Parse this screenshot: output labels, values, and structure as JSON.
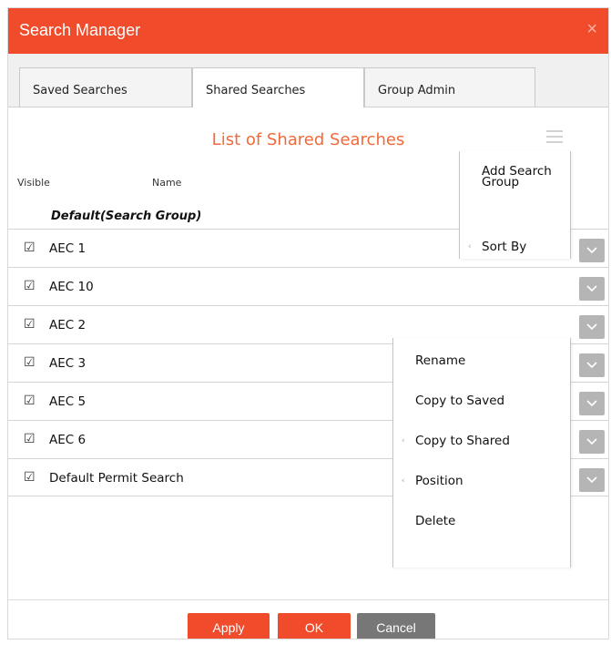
{
  "dialog": {
    "title": "Search Manager",
    "close_glyph": "×"
  },
  "tabs": [
    {
      "label": "Saved Searches"
    },
    {
      "label": "Shared Searches",
      "active": true
    },
    {
      "label": "Group Admin"
    }
  ],
  "list": {
    "heading": "List of Shared Searches",
    "columns": {
      "visible": "Visible",
      "name": "Name"
    },
    "group_name": "Default(Search Group)",
    "rows": [
      {
        "label": "AEC 1",
        "checked": true
      },
      {
        "label": "AEC 10",
        "checked": true
      },
      {
        "label": "AEC 2",
        "checked": true
      },
      {
        "label": "AEC 3",
        "checked": true
      },
      {
        "label": "AEC 5",
        "checked": true
      },
      {
        "label": "AEC 6",
        "checked": true
      },
      {
        "label": "Default Permit Search",
        "checked": true
      }
    ]
  },
  "group_menu": {
    "items": [
      "Add Search Group",
      "Sort By"
    ]
  },
  "row_menu": {
    "items": [
      "Rename",
      "Copy to Saved",
      "Copy to Shared",
      "Position",
      "Delete"
    ]
  },
  "icons": {
    "checkbox": "☑",
    "submenu": "‹",
    "dropdown": "chevron-down-icon",
    "menu": "hamburger-icon"
  },
  "footer": {
    "apply": "Apply",
    "ok": "OK",
    "cancel": "Cancel"
  },
  "colors": {
    "accent": "#f04b2b",
    "heading": "#f26a3a",
    "cancel": "#777777",
    "dropdown": "#b5b5b5"
  }
}
